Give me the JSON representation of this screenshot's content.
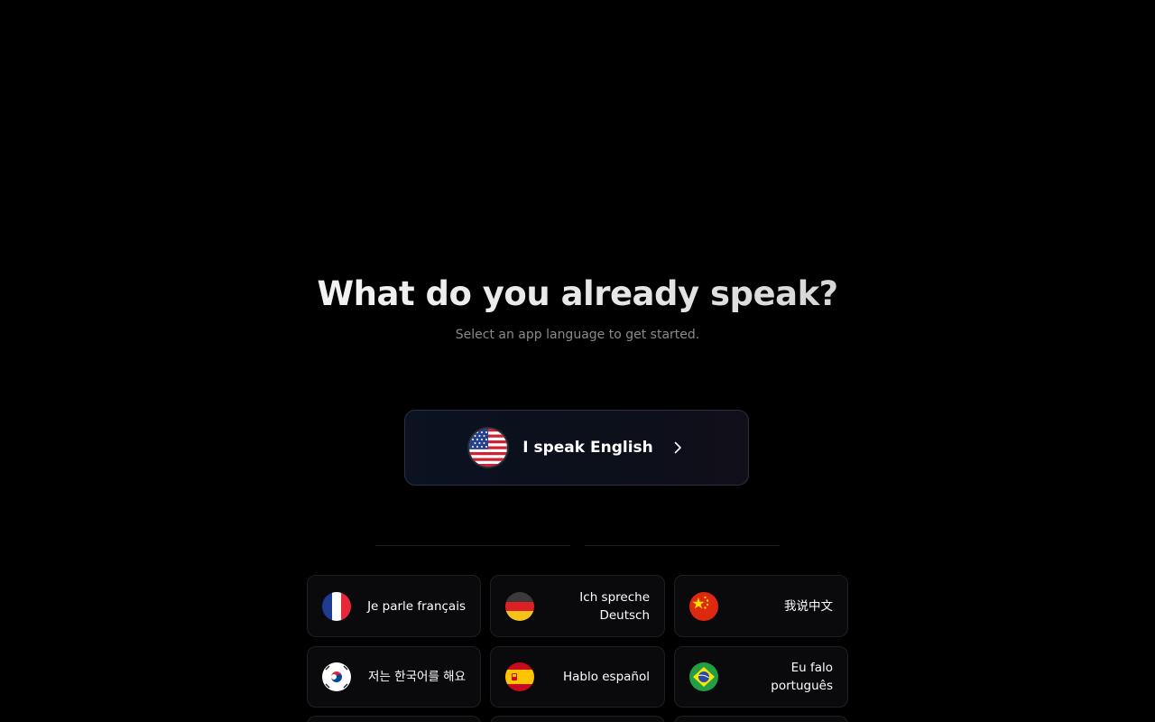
{
  "header": {
    "title": "What do you already speak?",
    "subtitle": "Select an app language to get started."
  },
  "primary_option": {
    "label": "I speak English",
    "flag": "us-flag-icon",
    "chevron": "chevron-right-icon"
  },
  "languages": [
    {
      "label": "Je parle français",
      "flag": "france-flag-icon"
    },
    {
      "label": "Ich spreche Deutsch",
      "flag": "germany-flag-icon"
    },
    {
      "label": "我说中文",
      "flag": "china-flag-icon"
    },
    {
      "label": "저는 한국어를 해요",
      "flag": "south-korea-flag-icon"
    },
    {
      "label": "Hablo español",
      "flag": "spain-flag-icon"
    },
    {
      "label": "Eu falo português",
      "flag": "brazil-flag-icon"
    }
  ],
  "colors": {
    "background": "#000000",
    "card_background": "#0a0a0c",
    "card_border": "#1e1e24",
    "subtitle": "#8a8a8a"
  }
}
